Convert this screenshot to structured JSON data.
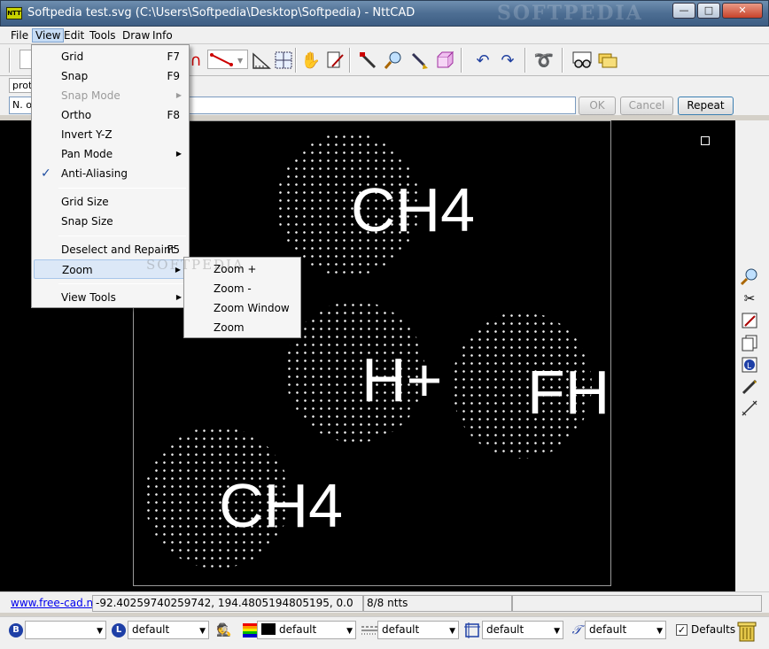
{
  "window": {
    "title": "Softpedia test.svg (C:\\Users\\Softpedia\\Desktop\\Softpedia) - NttCAD",
    "app_icon_text": "NTT",
    "watermark": "SOFTPEDIA",
    "controls": {
      "minimize": "—",
      "maximize": "□",
      "close": "✕"
    }
  },
  "menubar": {
    "items": [
      {
        "label": "File"
      },
      {
        "label": "View"
      },
      {
        "label": "Edit"
      },
      {
        "label": "Tools"
      },
      {
        "label": "Draw"
      },
      {
        "label": "Info"
      }
    ]
  },
  "toolbar": {
    "icons": [
      "magnet-icon",
      "line-style-icon",
      "ruler-square-icon",
      "grid-select-icon",
      "pan-hand-icon",
      "edit-page-icon",
      "marker-icon",
      "zoom-icon",
      "brush-icon",
      "cube-icon",
      "undo-icon",
      "redo-icon",
      "rope-icon",
      "glasses-icon",
      "folders-icon"
    ]
  },
  "row2": {
    "label": "prot"
  },
  "command": {
    "input_value": "N. of",
    "ok_label": "OK",
    "cancel_label": "Cancel",
    "repeat_label": "Repeat"
  },
  "view_menu": {
    "items": [
      {
        "label": "Grid",
        "key": "F7"
      },
      {
        "label": "Snap",
        "key": "F9"
      },
      {
        "label": "Snap Mode",
        "key": "",
        "submenu": true,
        "disabled": true
      },
      {
        "label": "Ortho",
        "key": "F8"
      },
      {
        "label": "Invert Y-Z",
        "key": ""
      },
      {
        "label": "Pan Mode",
        "key": "",
        "submenu": true
      },
      {
        "label": "Anti-Aliasing",
        "key": "",
        "checked": true
      },
      {
        "label": "Grid Size",
        "key": ""
      },
      {
        "label": "Snap Size",
        "key": ""
      },
      {
        "label": "Deselect and Repaint",
        "key": "F5"
      },
      {
        "label": "Zoom",
        "key": "",
        "submenu": true,
        "highlighted": true
      },
      {
        "label": "View Tools",
        "key": "",
        "submenu": true
      }
    ],
    "submenu_arrow": "▶",
    "check_glyph": "✓"
  },
  "zoom_submenu": {
    "items": [
      {
        "label": "Zoom +"
      },
      {
        "label": "Zoom -"
      },
      {
        "label": "Zoom Window"
      },
      {
        "label": "Zoom Extension"
      }
    ],
    "watermark": "SOFTPEDIA"
  },
  "drawing": {
    "labels": [
      "CH4",
      "H+",
      "FH",
      "CH4"
    ],
    "background": "#000000",
    "foreground": "#ffffff"
  },
  "status": {
    "link": "www.free-cad.net",
    "coordinates": "-92.40259740259742, 194.4805194805195, 0.0",
    "count": "8/8 ntts"
  },
  "bottom": {
    "b_letter": "B",
    "l_letter": "L",
    "layer_value": "default",
    "color_value": "default",
    "linetype_value": "default",
    "hatch_value": "default",
    "font_value": "default",
    "defaults_label": "Defaults",
    "defaults_checked": "✓"
  }
}
